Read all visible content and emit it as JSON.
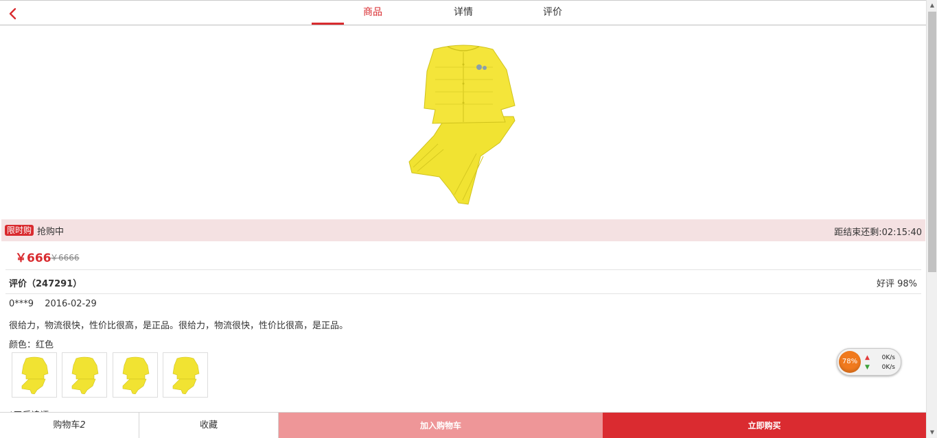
{
  "header": {
    "tabs": [
      {
        "label": "商品",
        "active": true
      },
      {
        "label": "详情",
        "active": false
      },
      {
        "label": "评价",
        "active": false
      }
    ]
  },
  "flash_sale": {
    "badge": "限时购",
    "status": "抢购中",
    "countdown": "距结束还剩:02:15:40"
  },
  "price": {
    "current": "￥666",
    "original": "￥6666"
  },
  "reviews": {
    "title": "评价（247291）",
    "positive_rate": "好评 98%",
    "item": {
      "user": "0***9",
      "date": "2016-02-29",
      "text": "很给力，物流很快，性价比很高，是正品。很给力，物流很快，性价比很高，是正品。",
      "color": "颜色：红色",
      "thumbnails": 4
    },
    "next_item_partial": "*天后追评"
  },
  "speed_widget": {
    "percent": "78%",
    "upload": "0K/s",
    "download": "0K/s"
  },
  "bottom_bar": {
    "cart": "购物车",
    "cart_count": "2",
    "favorite": "收藏",
    "add_to_cart": "加入购物车",
    "buy_now": "立即购买"
  },
  "colors": {
    "accent": "#d92b2f",
    "add_to_cart_bg": "#ee9698",
    "flash_bg": "#f4e1e2",
    "product_yellow": "#f1e332"
  }
}
